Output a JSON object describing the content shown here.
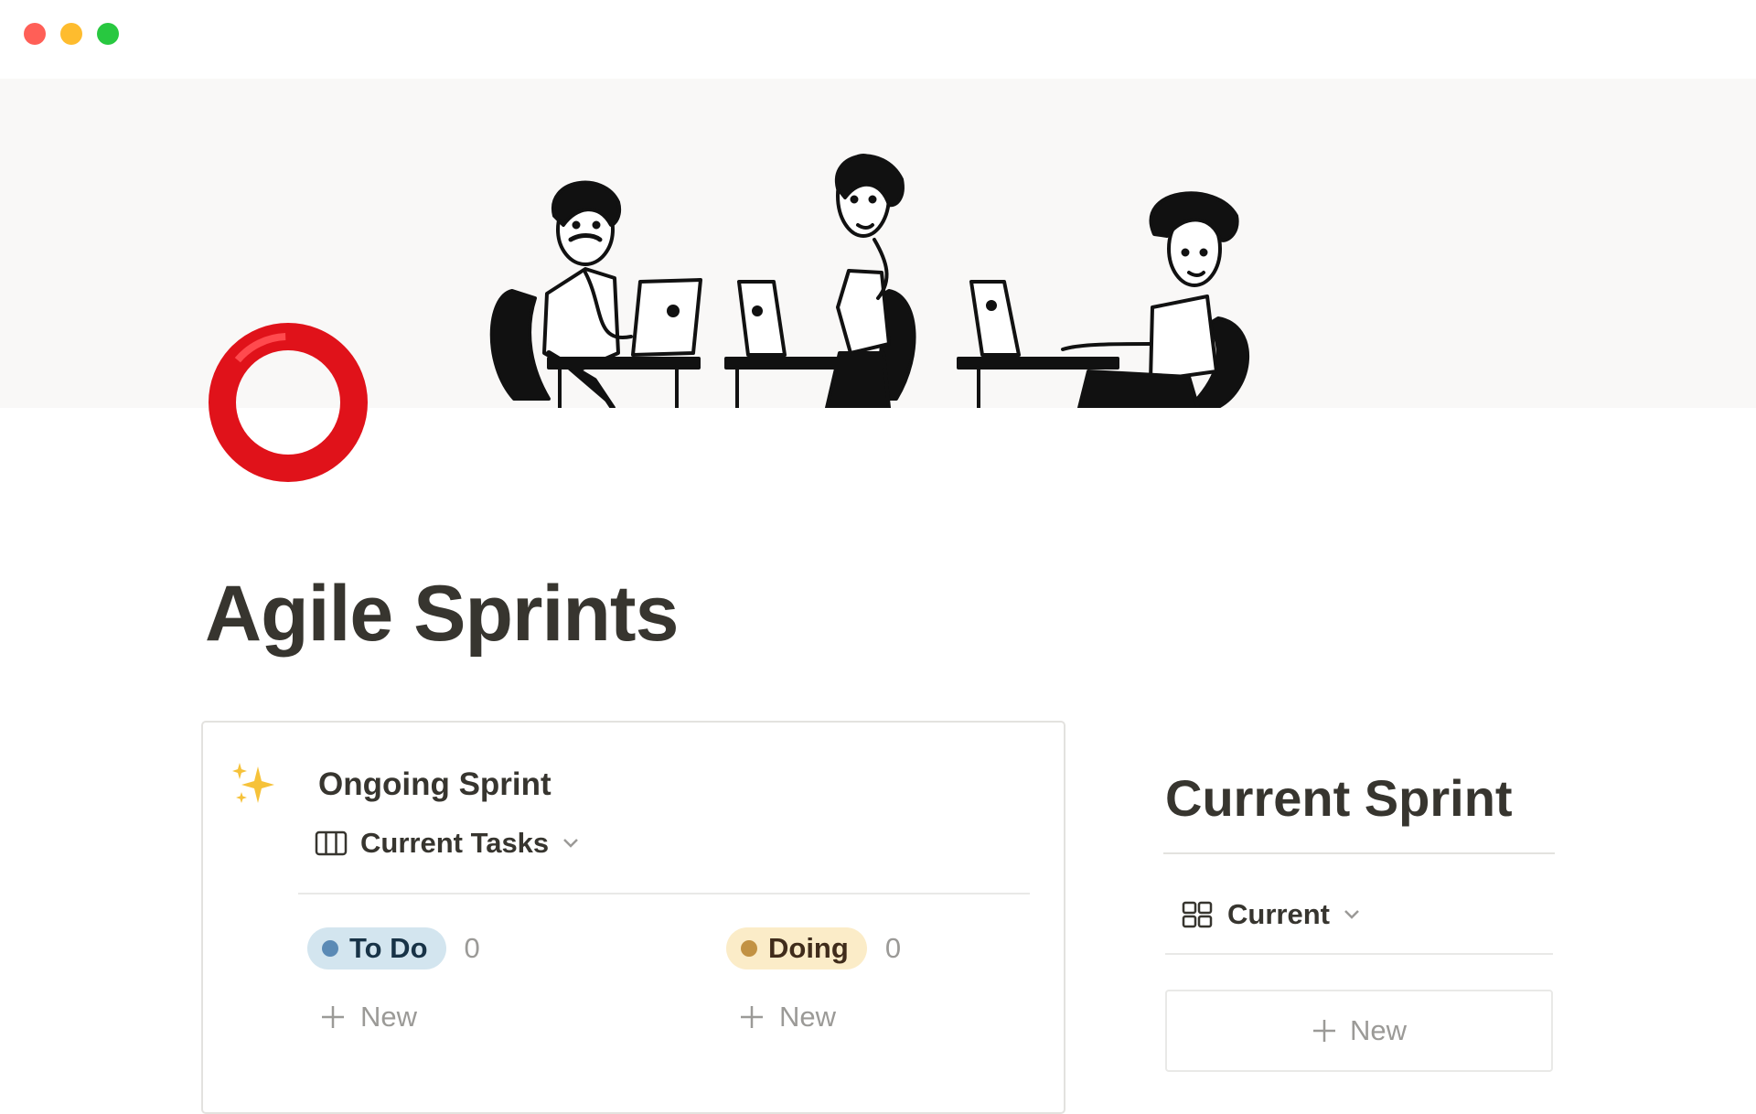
{
  "window": {
    "controls": [
      "close",
      "minimize",
      "zoom"
    ],
    "colors": {
      "close": "#ff5f57",
      "minimize": "#febc2e",
      "zoom": "#28c840"
    }
  },
  "cover": {
    "illustration": "three-people-working-at-laptops"
  },
  "page": {
    "icon": "red-ring-icon",
    "title": "Agile Sprints"
  },
  "ongoing_sprint": {
    "icon": "sparkles-icon",
    "title": "Ongoing Sprint",
    "view": {
      "icon": "board-view-icon",
      "label": "Current Tasks"
    },
    "columns": [
      {
        "label": "To Do",
        "count": "0",
        "new_label": "New",
        "color": "#d3e5ef",
        "dot_color": "#5b8ab5"
      },
      {
        "label": "Doing",
        "count": "0",
        "new_label": "New",
        "color": "#fbecc8",
        "dot_color": "#c29243"
      }
    ]
  },
  "current_sprint": {
    "title": "Current Sprint",
    "view": {
      "icon": "gallery-view-icon",
      "label": "Current"
    },
    "new_label": "New"
  }
}
